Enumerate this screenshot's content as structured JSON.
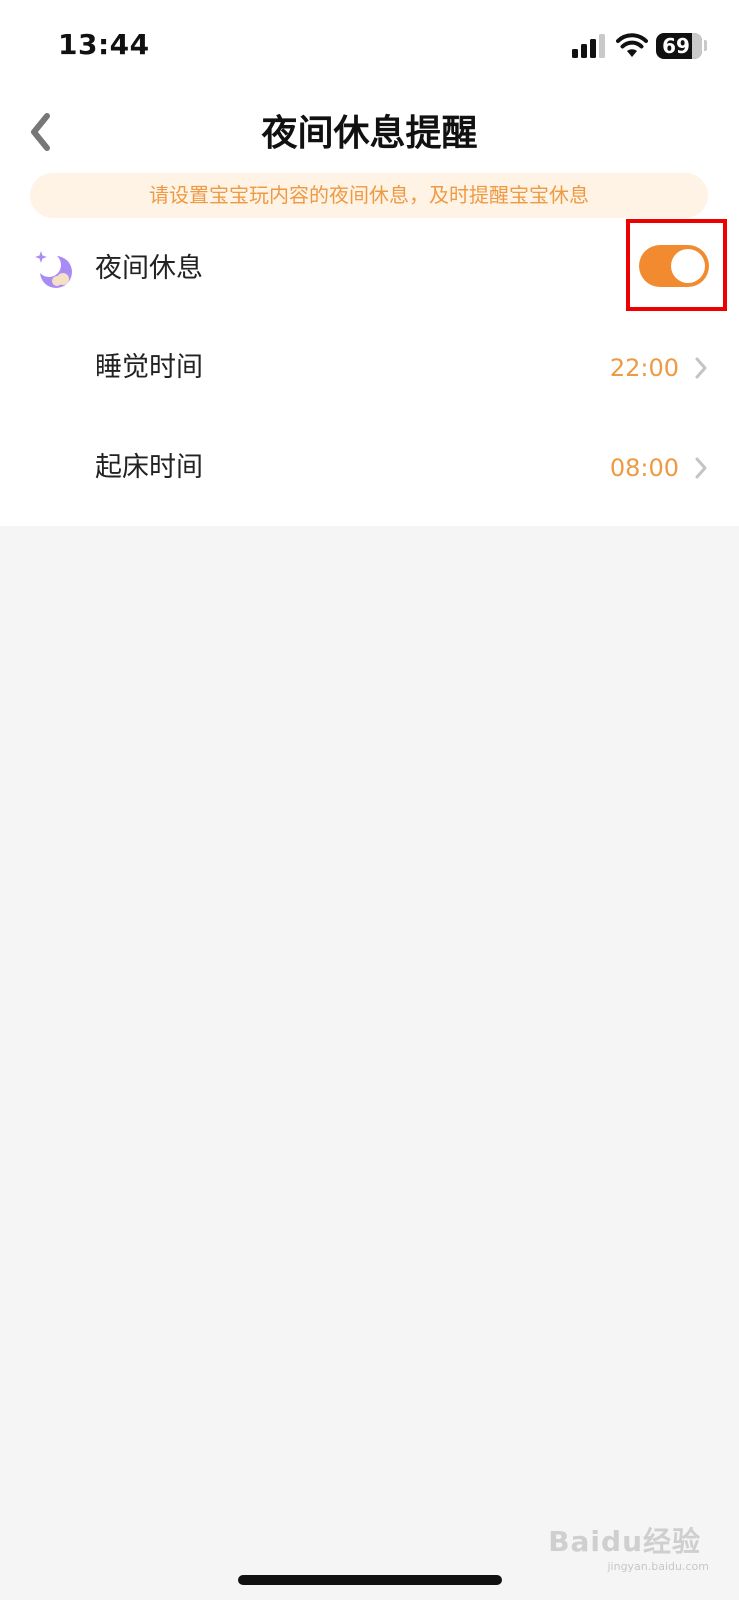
{
  "status_bar": {
    "time": "13:44",
    "battery_level": "69",
    "icons": [
      "signal-icon",
      "wifi-icon",
      "battery-icon"
    ]
  },
  "nav": {
    "title": "夜间休息提醒",
    "back_icon": "chevron-left-icon"
  },
  "notice": {
    "text": "请设置宝宝玩内容的夜间休息，及时提醒宝宝休息"
  },
  "settings": {
    "night_rest": {
      "label": "夜间休息",
      "icon": "moon-icon",
      "enabled": true
    },
    "sleep_time": {
      "label": "睡觉时间",
      "value": "22:00",
      "icon": "chevron-right-icon"
    },
    "wake_time": {
      "label": "起床时间",
      "value": "08:00",
      "icon": "chevron-right-icon"
    }
  },
  "colors": {
    "accent": "#f28a2f",
    "value_text": "#ee9a43",
    "notice_bg": "#fff3e6",
    "moon_purple": "#a98bf5",
    "highlight": "#ee0000"
  },
  "watermark": {
    "brand": "Baidu经验",
    "url": "jingyan.baidu.com"
  }
}
